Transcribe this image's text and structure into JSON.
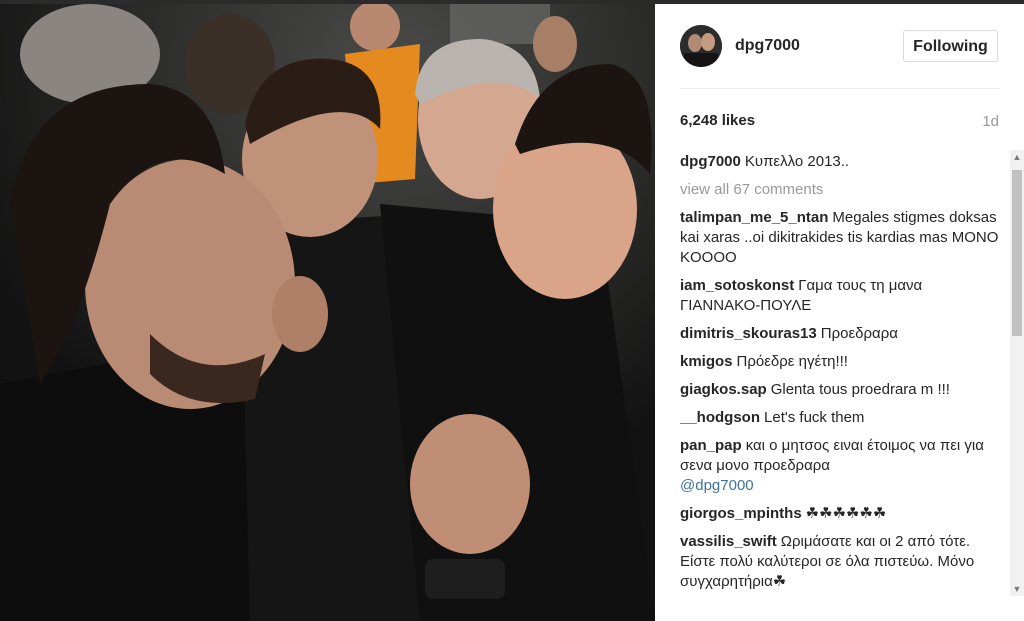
{
  "post": {
    "username": "dpg7000",
    "follow_label": "Following",
    "likes": "6,248 likes",
    "time": "1d",
    "caption": "Κυπελλο 2013..",
    "view_all": "view all 67 comments"
  },
  "comments": [
    {
      "user": "talimpan_me_5_ntan",
      "text": "Megales stigmes doksas kai xaras ..oi dikitrakides tis kardias mas MONO KOOOO"
    },
    {
      "user": "iam_sotoskonst",
      "text": "Γαμα τους τη μανα ΓΙΑΝΝΑΚΟ-ΠΟΥΛΕ"
    },
    {
      "user": "dimitris_skouras13",
      "text": "Προεδραρα"
    },
    {
      "user": "kmigos",
      "text": "Πρόεδρε ηγέτη!!!"
    },
    {
      "user": "giagkos.sap",
      "text": "Glenta tous proedrara m !!!"
    },
    {
      "user": "__hodgson",
      "text": "Let's fuck them"
    },
    {
      "user": "pan_pap",
      "text": "και ο μητσος ειναι έτοιμος να πει για σενα μονο προεδραρα",
      "mention": "@dpg7000"
    },
    {
      "user": "giorgos_mpinths",
      "text": "☘☘☘☘☘☘"
    },
    {
      "user": "vassilis_swift",
      "text": "Ωριμάσατε και οι 2 από τότε. Είστε πολύ καλύτεροι σε όλα πιστεύω. Μόνο συγχαρητήρια☘"
    }
  ],
  "icons": {
    "scroll_up": "▲",
    "scroll_down": "▼"
  },
  "colors": {
    "mention": "#3f729b",
    "muted": "#999999",
    "border": "#dbdbdb"
  }
}
